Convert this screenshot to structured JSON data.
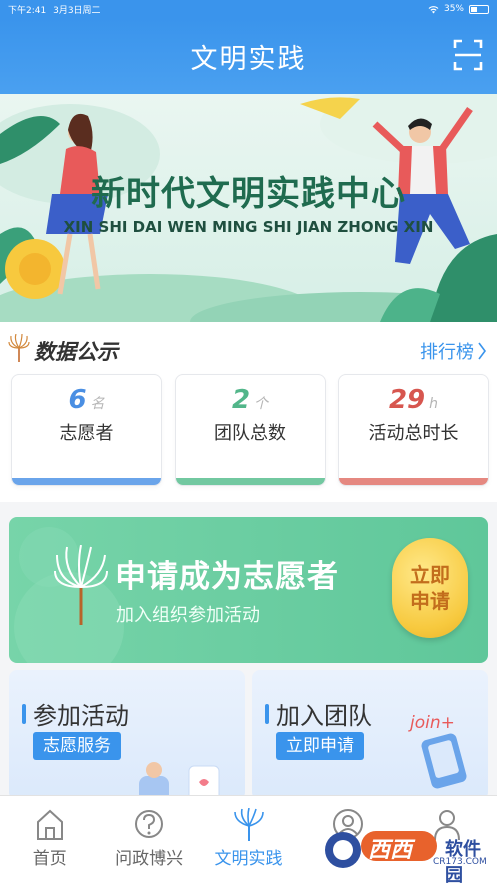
{
  "status_bar": {
    "time": "下午2:41",
    "date": "3月3日周二",
    "battery": "35%"
  },
  "header": {
    "title": "文明实践"
  },
  "banner": {
    "title": "新时代文明实践中心",
    "subtitle": "XIN SHI DAI WEN MING SHI JIAN ZHONG XIN"
  },
  "data_section": {
    "title": "数据公示",
    "rank_link": "排行榜",
    "cards": [
      {
        "value": "6",
        "unit": "名",
        "label": "志愿者",
        "color": "#4a8fe3",
        "bar": "#6aa4ea"
      },
      {
        "value": "2",
        "unit": "个",
        "label": "团队总数",
        "color": "#52b68a",
        "bar": "#72c8a0"
      },
      {
        "value": "29",
        "unit": "h",
        "label": "活动总时长",
        "color": "#d7564f",
        "bar": "#e58880"
      }
    ]
  },
  "apply": {
    "title": "申请成为志愿者",
    "subtitle": "加入组织参加活动",
    "button_line1": "立即",
    "button_line2": "申请"
  },
  "tiles": [
    {
      "title": "参加活动",
      "button": "志愿服务"
    },
    {
      "title": "加入团队",
      "button": "立即申请",
      "tag": "join+"
    }
  ],
  "tabbar": {
    "items": [
      {
        "label": "首页",
        "icon": "home-icon"
      },
      {
        "label": "问政博兴",
        "icon": "question-icon"
      },
      {
        "label": "文明实践",
        "icon": "peacock-fan-icon",
        "active": true
      },
      {
        "label": "我的",
        "icon": "user-icon"
      },
      {
        "label": "我的",
        "icon": "user-icon"
      }
    ]
  },
  "watermark": {
    "brand": "西西",
    "text": "软件园",
    "url": "CR173.COM"
  }
}
